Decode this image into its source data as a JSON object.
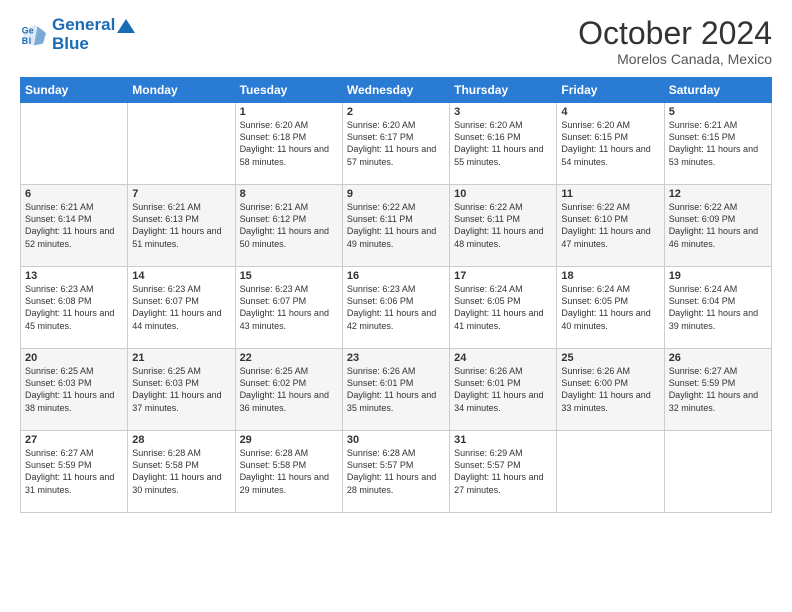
{
  "header": {
    "logo_line1": "General",
    "logo_line2": "Blue",
    "month": "October 2024",
    "location": "Morelos Canada, Mexico"
  },
  "days_of_week": [
    "Sunday",
    "Monday",
    "Tuesday",
    "Wednesday",
    "Thursday",
    "Friday",
    "Saturday"
  ],
  "weeks": [
    [
      {
        "day": "",
        "info": ""
      },
      {
        "day": "",
        "info": ""
      },
      {
        "day": "1",
        "info": "Sunrise: 6:20 AM\nSunset: 6:18 PM\nDaylight: 11 hours and 58 minutes."
      },
      {
        "day": "2",
        "info": "Sunrise: 6:20 AM\nSunset: 6:17 PM\nDaylight: 11 hours and 57 minutes."
      },
      {
        "day": "3",
        "info": "Sunrise: 6:20 AM\nSunset: 6:16 PM\nDaylight: 11 hours and 55 minutes."
      },
      {
        "day": "4",
        "info": "Sunrise: 6:20 AM\nSunset: 6:15 PM\nDaylight: 11 hours and 54 minutes."
      },
      {
        "day": "5",
        "info": "Sunrise: 6:21 AM\nSunset: 6:15 PM\nDaylight: 11 hours and 53 minutes."
      }
    ],
    [
      {
        "day": "6",
        "info": "Sunrise: 6:21 AM\nSunset: 6:14 PM\nDaylight: 11 hours and 52 minutes."
      },
      {
        "day": "7",
        "info": "Sunrise: 6:21 AM\nSunset: 6:13 PM\nDaylight: 11 hours and 51 minutes."
      },
      {
        "day": "8",
        "info": "Sunrise: 6:21 AM\nSunset: 6:12 PM\nDaylight: 11 hours and 50 minutes."
      },
      {
        "day": "9",
        "info": "Sunrise: 6:22 AM\nSunset: 6:11 PM\nDaylight: 11 hours and 49 minutes."
      },
      {
        "day": "10",
        "info": "Sunrise: 6:22 AM\nSunset: 6:11 PM\nDaylight: 11 hours and 48 minutes."
      },
      {
        "day": "11",
        "info": "Sunrise: 6:22 AM\nSunset: 6:10 PM\nDaylight: 11 hours and 47 minutes."
      },
      {
        "day": "12",
        "info": "Sunrise: 6:22 AM\nSunset: 6:09 PM\nDaylight: 11 hours and 46 minutes."
      }
    ],
    [
      {
        "day": "13",
        "info": "Sunrise: 6:23 AM\nSunset: 6:08 PM\nDaylight: 11 hours and 45 minutes."
      },
      {
        "day": "14",
        "info": "Sunrise: 6:23 AM\nSunset: 6:07 PM\nDaylight: 11 hours and 44 minutes."
      },
      {
        "day": "15",
        "info": "Sunrise: 6:23 AM\nSunset: 6:07 PM\nDaylight: 11 hours and 43 minutes."
      },
      {
        "day": "16",
        "info": "Sunrise: 6:23 AM\nSunset: 6:06 PM\nDaylight: 11 hours and 42 minutes."
      },
      {
        "day": "17",
        "info": "Sunrise: 6:24 AM\nSunset: 6:05 PM\nDaylight: 11 hours and 41 minutes."
      },
      {
        "day": "18",
        "info": "Sunrise: 6:24 AM\nSunset: 6:05 PM\nDaylight: 11 hours and 40 minutes."
      },
      {
        "day": "19",
        "info": "Sunrise: 6:24 AM\nSunset: 6:04 PM\nDaylight: 11 hours and 39 minutes."
      }
    ],
    [
      {
        "day": "20",
        "info": "Sunrise: 6:25 AM\nSunset: 6:03 PM\nDaylight: 11 hours and 38 minutes."
      },
      {
        "day": "21",
        "info": "Sunrise: 6:25 AM\nSunset: 6:03 PM\nDaylight: 11 hours and 37 minutes."
      },
      {
        "day": "22",
        "info": "Sunrise: 6:25 AM\nSunset: 6:02 PM\nDaylight: 11 hours and 36 minutes."
      },
      {
        "day": "23",
        "info": "Sunrise: 6:26 AM\nSunset: 6:01 PM\nDaylight: 11 hours and 35 minutes."
      },
      {
        "day": "24",
        "info": "Sunrise: 6:26 AM\nSunset: 6:01 PM\nDaylight: 11 hours and 34 minutes."
      },
      {
        "day": "25",
        "info": "Sunrise: 6:26 AM\nSunset: 6:00 PM\nDaylight: 11 hours and 33 minutes."
      },
      {
        "day": "26",
        "info": "Sunrise: 6:27 AM\nSunset: 5:59 PM\nDaylight: 11 hours and 32 minutes."
      }
    ],
    [
      {
        "day": "27",
        "info": "Sunrise: 6:27 AM\nSunset: 5:59 PM\nDaylight: 11 hours and 31 minutes."
      },
      {
        "day": "28",
        "info": "Sunrise: 6:28 AM\nSunset: 5:58 PM\nDaylight: 11 hours and 30 minutes."
      },
      {
        "day": "29",
        "info": "Sunrise: 6:28 AM\nSunset: 5:58 PM\nDaylight: 11 hours and 29 minutes."
      },
      {
        "day": "30",
        "info": "Sunrise: 6:28 AM\nSunset: 5:57 PM\nDaylight: 11 hours and 28 minutes."
      },
      {
        "day": "31",
        "info": "Sunrise: 6:29 AM\nSunset: 5:57 PM\nDaylight: 11 hours and 27 minutes."
      },
      {
        "day": "",
        "info": ""
      },
      {
        "day": "",
        "info": ""
      }
    ]
  ]
}
